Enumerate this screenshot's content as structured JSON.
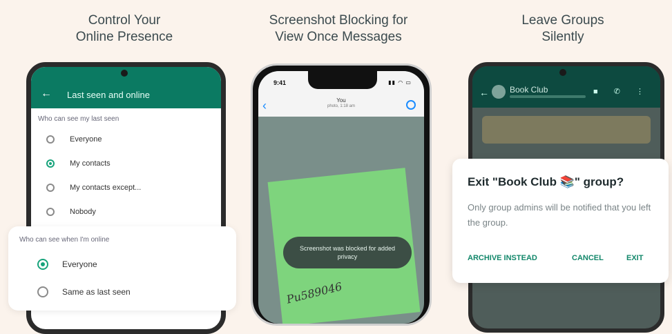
{
  "panels": [
    {
      "title_lines": [
        "Control Your",
        "Online Presence"
      ]
    },
    {
      "title_lines": [
        "Screenshot Blocking for",
        "View Once Messages"
      ]
    },
    {
      "title_lines": [
        "Leave Groups",
        "Silently"
      ]
    }
  ],
  "panel1": {
    "screen_title": "Last seen and online",
    "last_seen_question": "Who can see my last seen",
    "last_seen_options": [
      "Everyone",
      "My contacts",
      "My contacts except...",
      "Nobody"
    ],
    "last_seen_selected": 1,
    "online_question": "Who can see when I'm online",
    "online_options": [
      "Everyone",
      "Same as last seen"
    ],
    "online_selected": 0
  },
  "panel2": {
    "time": "9:41",
    "chat_name": "You",
    "chat_sub": "photo, 1:18 am",
    "toast": "Screenshot was blocked for added privacy",
    "handwriting": "Pu589046"
  },
  "panel3": {
    "group_name": "Book Club",
    "dialog_title": "Exit \"Book Club 📚\" group?",
    "dialog_body": "Only group admins will be notified that you left the group.",
    "btn_archive": "ARCHIVE INSTEAD",
    "btn_cancel": "CANCEL",
    "btn_exit": "EXIT"
  },
  "colors": {
    "background": "#fbf3ec",
    "whatsapp_green": "#0b7a62",
    "accent": "#17a37b",
    "sticky_note": "#7ed47d"
  }
}
